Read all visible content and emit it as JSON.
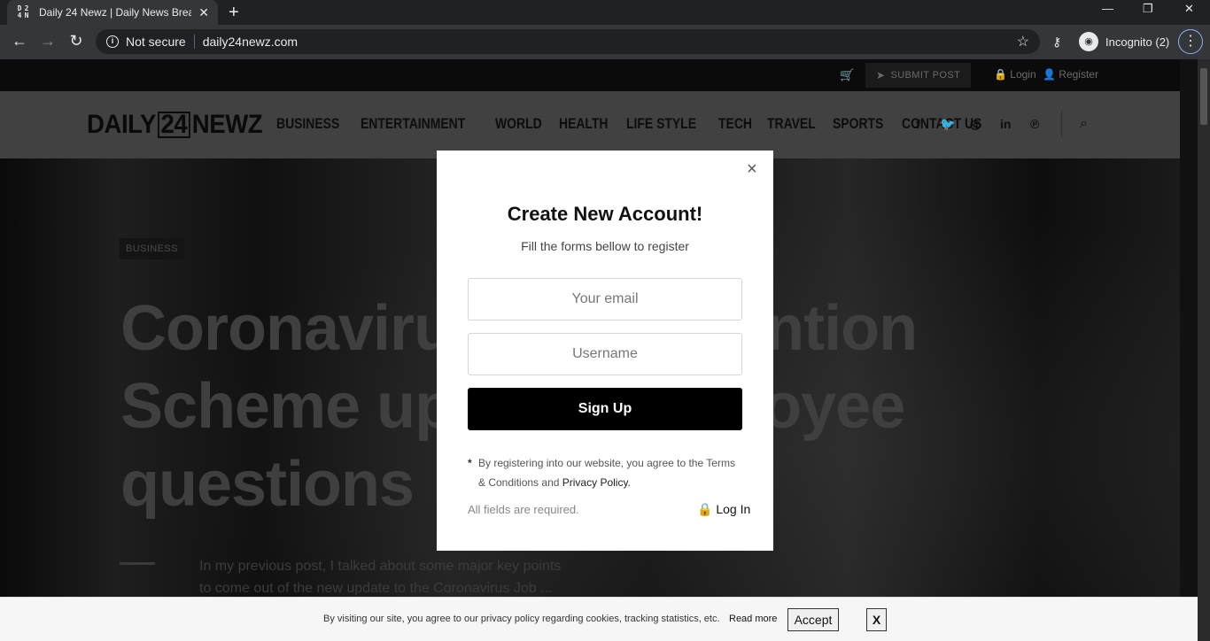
{
  "browser": {
    "tab_title": "Daily 24 Newz | Daily News Break",
    "tab_favicon": [
      "D",
      "2",
      "4",
      "N"
    ],
    "close_glyph": "✕",
    "new_tab_glyph": "+",
    "minimize_glyph": "—",
    "restore_glyph": "❐",
    "window_close_glyph": "✕",
    "back_glyph": "←",
    "forward_glyph": "→",
    "reload_glyph": "↻",
    "info_glyph": "i",
    "security_label": "Not secure",
    "url": "daily24newz.com",
    "star_glyph": "☆",
    "key_glyph": "⚷",
    "incognito_avatar_glyph": "◉",
    "incognito_label": "Incognito (2)",
    "menu_glyph": "⋮"
  },
  "site": {
    "topbar": {
      "cart_glyph": "🛒",
      "submit_icon": "➤",
      "submit_label": "SUBMIT POST",
      "login_label": "🔒 Login",
      "register_label": "👤 Register"
    },
    "logo": {
      "part1": "DAILY",
      "part2": "24",
      "part3": "NEWZ"
    },
    "nav": [
      "BUSINESS",
      "ENTERTAINMENT",
      "WORLD",
      "HEALTH",
      "LIFE STYLE",
      "TECH",
      "TRAVEL",
      "SPORTS",
      "CONTACT US"
    ],
    "social": {
      "facebook": "f",
      "twitter": "🐦",
      "instagram": "◎",
      "linkedin": "in",
      "pinterest": "℗"
    },
    "search_glyph": "⌕",
    "hero": {
      "category": "BUSINESS",
      "headline": "Coronavirus Job Retention Scheme update: employee questions",
      "excerpt": "In my previous post, I talked about some major key points to come out of the new update to the Coronavirus Job ..."
    }
  },
  "modal": {
    "close_glyph": "×",
    "title": "Create New Account!",
    "subtitle": "Fill the forms bellow to register",
    "email_placeholder": "Your email",
    "username_placeholder": "Username",
    "signup_label": "Sign Up",
    "terms_asterisk": "*",
    "terms_text": "By registering into our website, you agree to the",
    "terms_link": "Terms & Conditions",
    "terms_and": "and",
    "privacy_link": "Privacy Policy.",
    "required_text": "All fields are required.",
    "login_label": "🔒 Log In"
  },
  "cookie": {
    "text": "By visiting our site, you agree to our privacy policy regarding cookies, tracking statistics, etc.",
    "read_more": "Read more",
    "accept_label": "Accept",
    "dismiss_label": "X"
  },
  "colors": {
    "modal_bg": "#ffffff",
    "signup_bg": "#000000",
    "nav_bg": "#414141",
    "topbar_bg": "#0b0b0b"
  }
}
